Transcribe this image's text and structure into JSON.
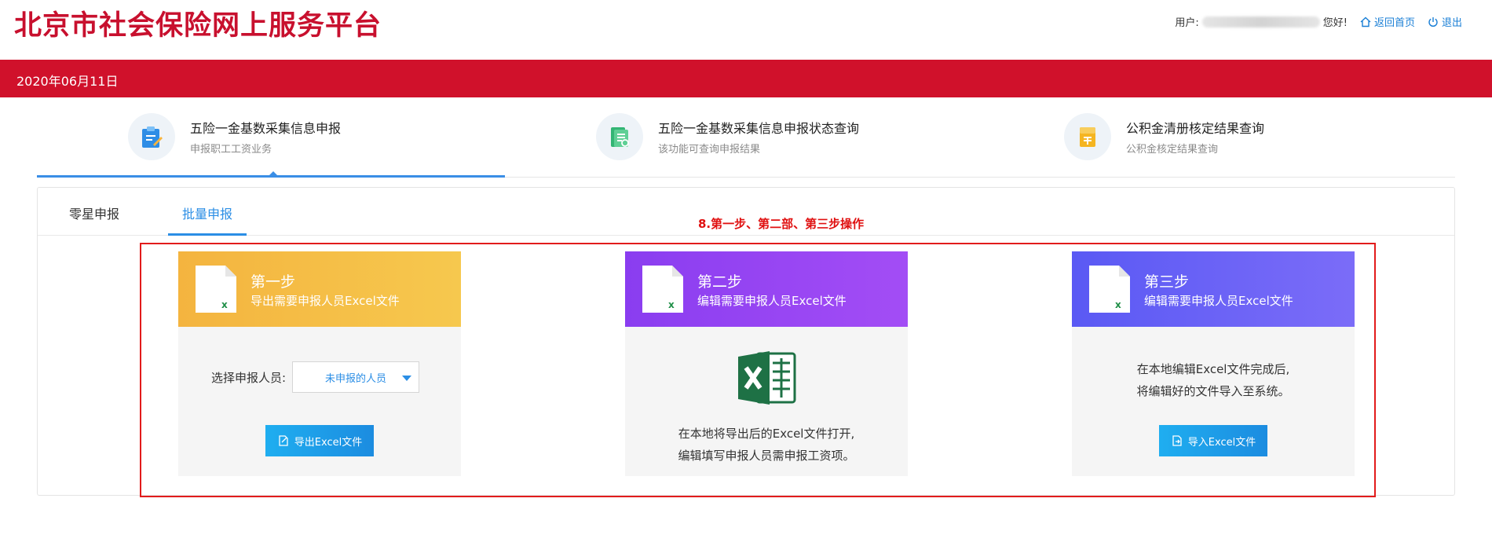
{
  "header": {
    "site_title": "北京市社会保险网上服务平台",
    "user_prefix": "用户:",
    "user_suffix": "您好!",
    "home_link": "返回首页",
    "logout_link": "退出"
  },
  "date_bar": {
    "date": "2020年06月11日"
  },
  "nav": [
    {
      "title": "五险一金基数采集信息申报",
      "subtitle": "申报职工工资业务"
    },
    {
      "title": "五险一金基数采集信息申报状态查询",
      "subtitle": "该功能可查询申报结果"
    },
    {
      "title": "公积金清册核定结果查询",
      "subtitle": "公积金核定结果查询"
    }
  ],
  "tabs": [
    {
      "label": "零星申报"
    },
    {
      "label": "批量申报"
    }
  ],
  "annotation": "8.第一步、第二部、第三步操作",
  "steps": [
    {
      "title": "第一步",
      "subtitle": "导出需要申报人员Excel文件",
      "select_label": "选择申报人员:",
      "select_value": "未申报的人员",
      "button": "导出Excel文件"
    },
    {
      "title": "第二步",
      "subtitle": "编辑需要申报人员Excel文件",
      "desc_line1": "在本地将导出后的Excel文件打开,",
      "desc_line2": "编辑填写申报人员需申报工资项。"
    },
    {
      "title": "第三步",
      "subtitle": "编辑需要申报人员Excel文件",
      "desc_line1": "在本地编辑Excel文件完成后,",
      "desc_line2": "将编辑好的文件导入至系统。",
      "button": "导入Excel文件"
    }
  ],
  "colors": {
    "brand_red": "#d0112b",
    "link_blue": "#1a7fd6",
    "step1": "#f6c84e",
    "step2": "#a34df5",
    "step3": "#7b6cf8"
  }
}
